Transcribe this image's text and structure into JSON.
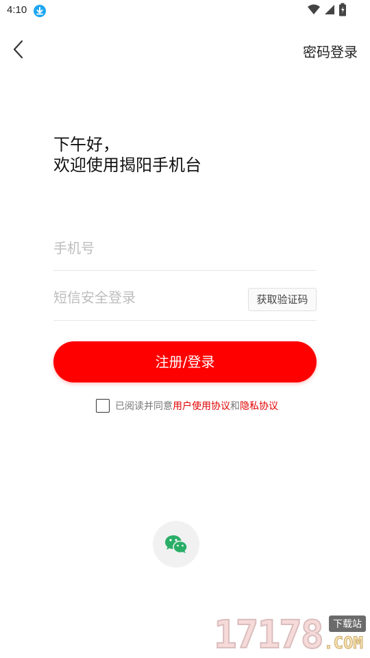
{
  "status_bar": {
    "time": "4:10",
    "download_icon": "download-arrow-icon",
    "signal_icons": [
      "wifi-icon",
      "cell-signal-icon",
      "battery-charging-icon"
    ]
  },
  "header": {
    "back_icon": "chevron-left-icon",
    "password_login_label": "密码登录"
  },
  "greeting": {
    "line1": "下午好，",
    "line2": "欢迎使用揭阳手机台"
  },
  "form": {
    "phone_placeholder": "手机号",
    "sms_placeholder": "短信安全登录",
    "get_code_label": "获取验证码",
    "submit_label": "注册/登录"
  },
  "agreement": {
    "prefix": "已阅读并同意",
    "user_agreement": "用户使用协议",
    "and": "和",
    "privacy_agreement": "隐私协议"
  },
  "third_party": {
    "wechat_icon": "wechat-icon"
  },
  "watermark": {
    "digits": "17178",
    "badge": "下载站",
    "suffix": ".COM"
  },
  "colors": {
    "accent": "#ff0000",
    "link": "#e00000",
    "wechat": "#2aae67"
  }
}
